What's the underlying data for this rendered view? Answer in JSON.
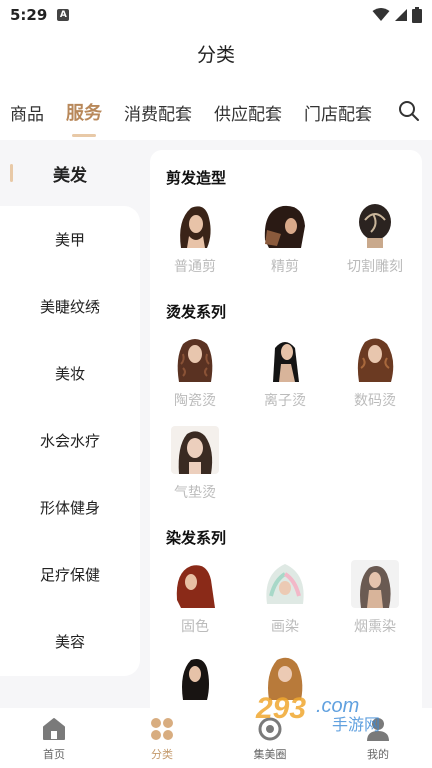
{
  "status": {
    "time": "5:29",
    "notification_letter": "A"
  },
  "title": "分类",
  "top_tabs": [
    "商品",
    "服务",
    "消费配套",
    "供应配套",
    "门店配套"
  ],
  "sidebar": {
    "active": "美发",
    "items": [
      "美甲",
      "美睫纹绣",
      "美妆",
      "水会水疗",
      "形体健身",
      "足疗保健",
      "美容"
    ]
  },
  "sections": [
    {
      "title": "剪发造型",
      "items": [
        {
          "label": "普通剪",
          "icon": "hair-photo"
        },
        {
          "label": "精剪",
          "icon": "hair-photo"
        },
        {
          "label": "切割雕刻",
          "icon": "hair-photo"
        }
      ]
    },
    {
      "title": "烫发系列",
      "items": [
        {
          "label": "陶瓷烫",
          "icon": "hair-photo"
        },
        {
          "label": "离子烫",
          "icon": "hair-photo"
        },
        {
          "label": "数码烫",
          "icon": "hair-photo"
        },
        {
          "label": "气垫烫",
          "icon": "hair-photo"
        }
      ]
    },
    {
      "title": "染发系列",
      "items": [
        {
          "label": "固色",
          "icon": "hair-photo"
        },
        {
          "label": "画染",
          "icon": "hair-photo"
        },
        {
          "label": "烟熏染",
          "icon": "hair-photo"
        }
      ]
    }
  ],
  "bottom_nav": [
    {
      "label": "首页",
      "icon": "home-icon"
    },
    {
      "label": "分类",
      "icon": "category-icon"
    },
    {
      "label": "集美圈",
      "icon": "circle-icon"
    },
    {
      "label": "我的",
      "icon": "user-icon"
    }
  ],
  "watermark": {
    "brand": "293",
    "text": "手游网"
  },
  "colors": {
    "accent": "#c49a6c",
    "tab_active": "#b8885a",
    "muted": "#bbbbbb",
    "bg": "#f6f6f8"
  }
}
